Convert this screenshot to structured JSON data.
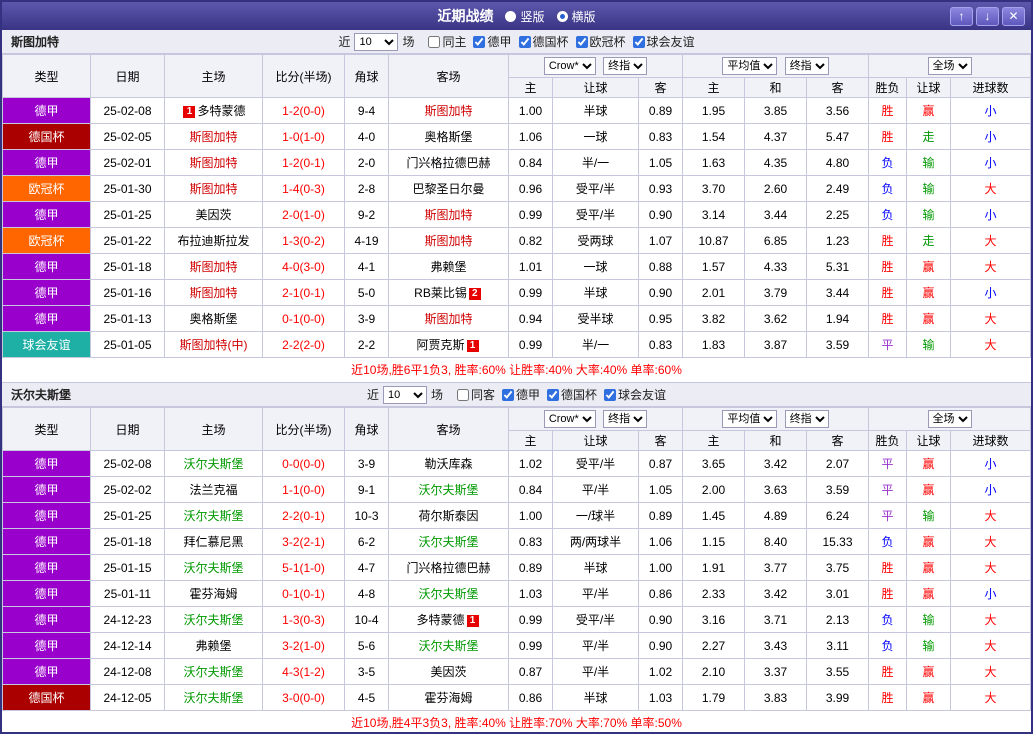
{
  "titlebar": {
    "title": "近期战绩",
    "modes": [
      {
        "label": "竖版",
        "selected": false
      },
      {
        "label": "横版",
        "selected": true
      }
    ],
    "up_icon": "↑",
    "down_icon": "↓",
    "close_icon": "✕"
  },
  "labels": {
    "near": "近",
    "games": "场"
  },
  "table_header": {
    "type": "类型",
    "date": "日期",
    "home": "主场",
    "score": "比分(半场)",
    "corner": "角球",
    "away": "客场",
    "asian_company": "Crow*",
    "asian_index": "终指",
    "euro_company": "平均值",
    "euro_index": "终指",
    "scope": "全场",
    "a_home": "主",
    "a_line": "让球",
    "a_away": "客",
    "e_home": "主",
    "e_draw": "和",
    "e_away": "客",
    "result": "胜负",
    "handicap": "让球",
    "goals": "进球数"
  },
  "league_colors": {
    "德甲": "#9900cc",
    "德国杯": "#aa0000",
    "欧冠杯": "#ff6600",
    "球会友谊": "#1fb0a5"
  },
  "result_colors": {
    "胜": "#ff0000",
    "平": "#9933cc",
    "负": "#0000ff",
    "赢": "#ff0000",
    "走": "#009900",
    "输": "#009900",
    "大": "#ff0000",
    "小": "#0000ff"
  },
  "score_color": "#ff0000",
  "sections": [
    {
      "team": "斯图加特",
      "focus_color": "#d00000",
      "recent_count": "10",
      "filters": [
        {
          "label": "同主",
          "checked": false
        },
        {
          "label": "德甲",
          "checked": true
        },
        {
          "label": "德国杯",
          "checked": true
        },
        {
          "label": "欧冠杯",
          "checked": true
        },
        {
          "label": "球会友谊",
          "checked": true
        }
      ],
      "rows": [
        {
          "league": "德甲",
          "date": "25-02-08",
          "home": "多特蒙德",
          "home_badge": "1",
          "home_badge_pos": "before",
          "home_focus": false,
          "score": "1-2(0-0)",
          "corner": "9-4",
          "away": "斯图加特",
          "away_focus": true,
          "a_home": "1.00",
          "a_line": "半球",
          "a_away": "0.89",
          "e_home": "1.95",
          "e_draw": "3.85",
          "e_away": "3.56",
          "result": "胜",
          "handicap": "赢",
          "goals": "小"
        },
        {
          "league": "德国杯",
          "date": "25-02-05",
          "home": "斯图加特",
          "home_focus": true,
          "score": "1-0(1-0)",
          "corner": "4-0",
          "away": "奥格斯堡",
          "away_focus": false,
          "a_home": "1.06",
          "a_line": "一球",
          "a_away": "0.83",
          "e_home": "1.54",
          "e_draw": "4.37",
          "e_away": "5.47",
          "result": "胜",
          "handicap": "走",
          "goals": "小"
        },
        {
          "league": "德甲",
          "date": "25-02-01",
          "home": "斯图加特",
          "home_focus": true,
          "score": "1-2(0-1)",
          "corner": "2-0",
          "away": "门兴格拉德巴赫",
          "away_focus": false,
          "a_home": "0.84",
          "a_line": "半/一",
          "a_away": "1.05",
          "e_home": "1.63",
          "e_draw": "4.35",
          "e_away": "4.80",
          "result": "负",
          "handicap": "输",
          "goals": "小"
        },
        {
          "league": "欧冠杯",
          "date": "25-01-30",
          "home": "斯图加特",
          "home_focus": true,
          "score": "1-4(0-3)",
          "corner": "2-8",
          "away": "巴黎圣日尔曼",
          "away_focus": false,
          "a_home": "0.96",
          "a_line": "受平/半",
          "a_away": "0.93",
          "e_home": "3.70",
          "e_draw": "2.60",
          "e_away": "2.49",
          "result": "负",
          "handicap": "输",
          "goals": "大"
        },
        {
          "league": "德甲",
          "date": "25-01-25",
          "home": "美因茨",
          "home_focus": false,
          "score": "2-0(1-0)",
          "corner": "9-2",
          "away": "斯图加特",
          "away_focus": true,
          "a_home": "0.99",
          "a_line": "受平/半",
          "a_away": "0.90",
          "e_home": "3.14",
          "e_draw": "3.44",
          "e_away": "2.25",
          "result": "负",
          "handicap": "输",
          "goals": "小"
        },
        {
          "league": "欧冠杯",
          "date": "25-01-22",
          "home": "布拉迪斯拉发",
          "home_focus": false,
          "score": "1-3(0-2)",
          "corner": "4-19",
          "away": "斯图加特",
          "away_focus": true,
          "a_home": "0.82",
          "a_line": "受两球",
          "a_away": "1.07",
          "e_home": "10.87",
          "e_draw": "6.85",
          "e_away": "1.23",
          "result": "胜",
          "handicap": "走",
          "goals": "大"
        },
        {
          "league": "德甲",
          "date": "25-01-18",
          "home": "斯图加特",
          "home_focus": true,
          "score": "4-0(3-0)",
          "corner": "4-1",
          "away": "弗赖堡",
          "away_focus": false,
          "a_home": "1.01",
          "a_line": "一球",
          "a_away": "0.88",
          "e_home": "1.57",
          "e_draw": "4.33",
          "e_away": "5.31",
          "result": "胜",
          "handicap": "赢",
          "goals": "大"
        },
        {
          "league": "德甲",
          "date": "25-01-16",
          "home": "斯图加特",
          "home_focus": true,
          "score": "2-1(0-1)",
          "corner": "5-0",
          "away": "RB莱比锡",
          "away_badge": "2",
          "away_badge_pos": "after",
          "away_focus": false,
          "a_home": "0.99",
          "a_line": "半球",
          "a_away": "0.90",
          "e_home": "2.01",
          "e_draw": "3.79",
          "e_away": "3.44",
          "result": "胜",
          "handicap": "赢",
          "goals": "小"
        },
        {
          "league": "德甲",
          "date": "25-01-13",
          "home": "奥格斯堡",
          "home_focus": false,
          "score": "0-1(0-0)",
          "corner": "3-9",
          "away": "斯图加特",
          "away_focus": true,
          "a_home": "0.94",
          "a_line": "受半球",
          "a_away": "0.95",
          "e_home": "3.82",
          "e_draw": "3.62",
          "e_away": "1.94",
          "result": "胜",
          "handicap": "赢",
          "goals": "大"
        },
        {
          "league": "球会友谊",
          "date": "25-01-05",
          "home": "斯图加特(中)",
          "home_focus": true,
          "score": "2-2(2-0)",
          "corner": "2-2",
          "away": "阿贾克斯",
          "away_badge": "1",
          "away_badge_pos": "after",
          "away_focus": false,
          "a_home": "0.99",
          "a_line": "半/一",
          "a_away": "0.83",
          "e_home": "1.83",
          "e_draw": "3.87",
          "e_away": "3.59",
          "result": "平",
          "handicap": "输",
          "goals": "大"
        }
      ],
      "summary": "近10场,胜6平1负3, 胜率:60% 让胜率:40% 大率:40% 单率:60%"
    },
    {
      "team": "沃尔夫斯堡",
      "focus_color": "#009900",
      "recent_count": "10",
      "filters": [
        {
          "label": "同客",
          "checked": false
        },
        {
          "label": "德甲",
          "checked": true
        },
        {
          "label": "德国杯",
          "checked": true
        },
        {
          "label": "球会友谊",
          "checked": true
        }
      ],
      "rows": [
        {
          "league": "德甲",
          "date": "25-02-08",
          "home": "沃尔夫斯堡",
          "home_focus": true,
          "score": "0-0(0-0)",
          "corner": "3-9",
          "away": "勒沃库森",
          "away_focus": false,
          "a_home": "1.02",
          "a_line": "受平/半",
          "a_away": "0.87",
          "e_home": "3.65",
          "e_draw": "3.42",
          "e_away": "2.07",
          "result": "平",
          "handicap": "赢",
          "goals": "小"
        },
        {
          "league": "德甲",
          "date": "25-02-02",
          "home": "法兰克福",
          "home_focus": false,
          "score": "1-1(0-0)",
          "corner": "9-1",
          "away": "沃尔夫斯堡",
          "away_focus": true,
          "a_home": "0.84",
          "a_line": "平/半",
          "a_away": "1.05",
          "e_home": "2.00",
          "e_draw": "3.63",
          "e_away": "3.59",
          "result": "平",
          "handicap": "赢",
          "goals": "小"
        },
        {
          "league": "德甲",
          "date": "25-01-25",
          "home": "沃尔夫斯堡",
          "home_focus": true,
          "score": "2-2(0-1)",
          "corner": "10-3",
          "away": "荷尔斯泰因",
          "away_focus": false,
          "a_home": "1.00",
          "a_line": "一/球半",
          "a_away": "0.89",
          "e_home": "1.45",
          "e_draw": "4.89",
          "e_away": "6.24",
          "result": "平",
          "handicap": "输",
          "goals": "大"
        },
        {
          "league": "德甲",
          "date": "25-01-18",
          "home": "拜仁慕尼黑",
          "home_focus": false,
          "score": "3-2(2-1)",
          "corner": "6-2",
          "away": "沃尔夫斯堡",
          "away_focus": true,
          "a_home": "0.83",
          "a_line": "两/两球半",
          "a_away": "1.06",
          "e_home": "1.15",
          "e_draw": "8.40",
          "e_away": "15.33",
          "result": "负",
          "handicap": "赢",
          "goals": "大"
        },
        {
          "league": "德甲",
          "date": "25-01-15",
          "home": "沃尔夫斯堡",
          "home_focus": true,
          "score": "5-1(1-0)",
          "corner": "4-7",
          "away": "门兴格拉德巴赫",
          "away_focus": false,
          "a_home": "0.89",
          "a_line": "半球",
          "a_away": "1.00",
          "e_home": "1.91",
          "e_draw": "3.77",
          "e_away": "3.75",
          "result": "胜",
          "handicap": "赢",
          "goals": "大"
        },
        {
          "league": "德甲",
          "date": "25-01-11",
          "home": "霍芬海姆",
          "home_focus": false,
          "score": "0-1(0-1)",
          "corner": "4-8",
          "away": "沃尔夫斯堡",
          "away_focus": true,
          "a_home": "1.03",
          "a_line": "平/半",
          "a_away": "0.86",
          "e_home": "2.33",
          "e_draw": "3.42",
          "e_away": "3.01",
          "result": "胜",
          "handicap": "赢",
          "goals": "小"
        },
        {
          "league": "德甲",
          "date": "24-12-23",
          "home": "沃尔夫斯堡",
          "home_focus": true,
          "score": "1-3(0-3)",
          "corner": "10-4",
          "away": "多特蒙德",
          "away_badge": "1",
          "away_badge_pos": "after",
          "away_focus": false,
          "a_home": "0.99",
          "a_line": "受平/半",
          "a_away": "0.90",
          "e_home": "3.16",
          "e_draw": "3.71",
          "e_away": "2.13",
          "result": "负",
          "handicap": "输",
          "goals": "大"
        },
        {
          "league": "德甲",
          "date": "24-12-14",
          "home": "弗赖堡",
          "home_focus": false,
          "score": "3-2(1-0)",
          "corner": "5-6",
          "away": "沃尔夫斯堡",
          "away_focus": true,
          "a_home": "0.99",
          "a_line": "平/半",
          "a_away": "0.90",
          "e_home": "2.27",
          "e_draw": "3.43",
          "e_away": "3.11",
          "result": "负",
          "handicap": "输",
          "goals": "大"
        },
        {
          "league": "德甲",
          "date": "24-12-08",
          "home": "沃尔夫斯堡",
          "home_focus": true,
          "score": "4-3(1-2)",
          "corner": "3-5",
          "away": "美因茨",
          "away_focus": false,
          "a_home": "0.87",
          "a_line": "平/半",
          "a_away": "1.02",
          "e_home": "2.10",
          "e_draw": "3.37",
          "e_away": "3.55",
          "result": "胜",
          "handicap": "赢",
          "goals": "大"
        },
        {
          "league": "德国杯",
          "date": "24-12-05",
          "home": "沃尔夫斯堡",
          "home_focus": true,
          "score": "3-0(0-0)",
          "corner": "4-5",
          "away": "霍芬海姆",
          "away_focus": false,
          "a_home": "0.86",
          "a_line": "半球",
          "a_away": "1.03",
          "e_home": "1.79",
          "e_draw": "3.83",
          "e_away": "3.99",
          "result": "胜",
          "handicap": "赢",
          "goals": "大"
        }
      ],
      "summary": "近10场,胜4平3负3, 胜率:40% 让胜率:70% 大率:70% 单率:50%"
    }
  ]
}
